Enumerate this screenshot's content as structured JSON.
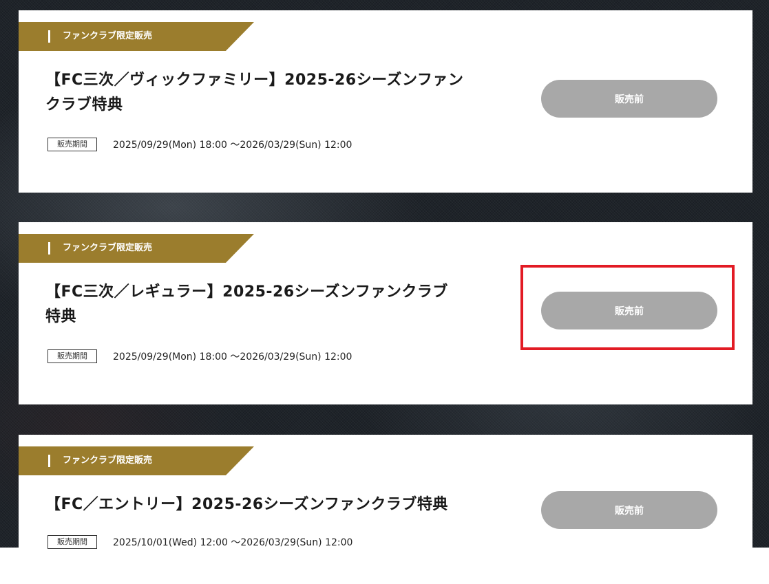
{
  "products": [
    {
      "tag": "ファンクラブ限定販売",
      "title_lines": [
        "【FC三次／ヴィックファミリー】2025-26シーズンファン",
        "クラブ特典"
      ],
      "period_label": "販売期間",
      "period": "2025/09/29(Mon) 18:00 ～2026/03/29(Sun) 12:00",
      "status_button": "販売前"
    },
    {
      "tag": "ファンクラブ限定販売",
      "title_lines": [
        "【FC三次／レギュラー】2025-26シーズンファンクラブ",
        "特典"
      ],
      "period_label": "販売期間",
      "period": "2025/09/29(Mon) 18:00 ～2026/03/29(Sun) 12:00",
      "status_button": "販売前"
    },
    {
      "tag": "ファンクラブ限定販売",
      "title_lines": [
        "【FC／エントリー】2025-26シーズンファンクラブ特典"
      ],
      "period_label": "販売期間",
      "period": "2025/10/01(Wed) 12:00 ～2026/03/29(Sun) 12:00",
      "status_button": "販売前"
    }
  ],
  "colors": {
    "tag_gold": "#9b7d2d",
    "button_gray": "#a8a8a8",
    "highlight_red": "#e21b24",
    "background_dark": "#1e2329"
  }
}
